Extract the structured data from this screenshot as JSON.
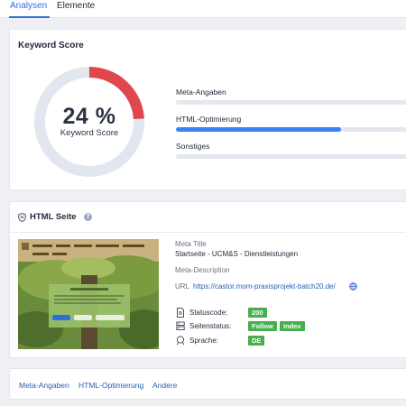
{
  "tabs": [
    {
      "label": "Analysen",
      "active": true
    },
    {
      "label": "Elemente",
      "active": false
    }
  ],
  "keyword_score": {
    "title": "Keyword Score",
    "value_text": "24 %",
    "value": 24,
    "label": "Keyword Score",
    "colors": {
      "score": "#e0474c",
      "track": "#e2e6ee"
    },
    "metrics": [
      {
        "label": "Meta-Angaben",
        "progress": 0
      },
      {
        "label": "HTML-Optimierung",
        "progress": 70
      },
      {
        "label": "Sonstiges",
        "progress": 0
      }
    ]
  },
  "html_page": {
    "title": "HTML Seite",
    "icon": "shield-icon",
    "help_icon": "?",
    "meta_title_label": "Meta Title",
    "meta_title_value": "Startseite - UCM&S - Dienstleistungen",
    "meta_description_label": "Meta-Description",
    "url_label": "URL",
    "url_value": "https://castor.mom-praxisprojekt-batch20.de/",
    "statuses": [
      {
        "icon": "document-icon",
        "label": "Statuscode:",
        "badges": [
          "200"
        ]
      },
      {
        "icon": "server-icon",
        "label": "Seitenstatus:",
        "badges": [
          "Follow",
          "Index"
        ]
      },
      {
        "icon": "language-icon",
        "label": "Sprache:",
        "badges": [
          "DE"
        ]
      }
    ],
    "badge_color": "#46b04e"
  },
  "bottom_links": [
    "Meta-Angaben",
    "HTML-Optimierung",
    "Andere"
  ],
  "colors": {
    "accent": "#2f6fdb",
    "link": "#2b5fb8",
    "progress": "#3b82f6"
  }
}
